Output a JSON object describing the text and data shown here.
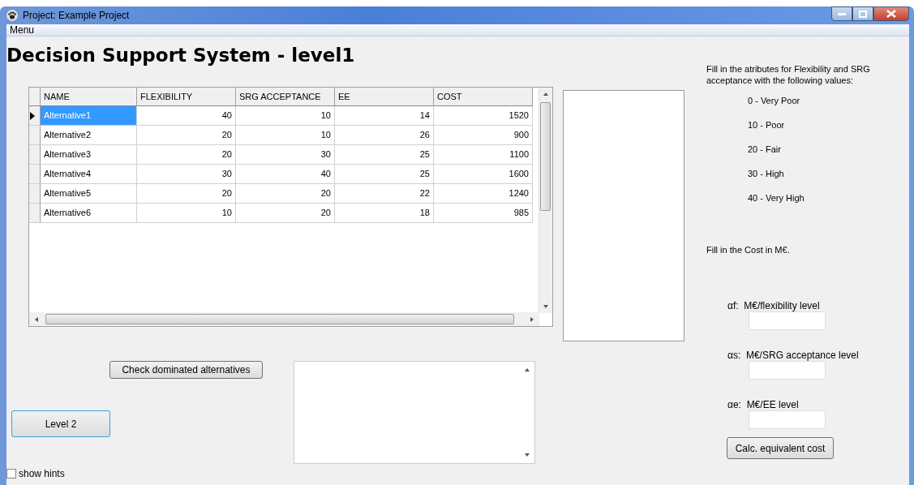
{
  "window": {
    "title": "Project: Example Project"
  },
  "menu": [
    "Menu"
  ],
  "heading": "Decision Support System - level1",
  "table": {
    "columns": [
      "NAME",
      "FLEXIBILITY",
      "SRG ACCEPTANCE",
      "EE",
      "COST"
    ],
    "rows": [
      {
        "cells": [
          "Alternative1",
          "40",
          "10",
          "14",
          "1520"
        ],
        "selected": true
      },
      {
        "cells": [
          "Alternative2",
          "20",
          "10",
          "26",
          "900"
        ],
        "selected": false
      },
      {
        "cells": [
          "Alternative3",
          "20",
          "30",
          "25",
          "1100"
        ],
        "selected": false
      },
      {
        "cells": [
          "Alternative4",
          "30",
          "40",
          "25",
          "1600"
        ],
        "selected": false
      },
      {
        "cells": [
          "Alternative5",
          "20",
          "20",
          "22",
          "1240"
        ],
        "selected": false
      },
      {
        "cells": [
          "Alternative6",
          "10",
          "20",
          "18",
          "985"
        ],
        "selected": false
      }
    ]
  },
  "check_button": "Check dominated alternatives",
  "level_button": "Level 2",
  "show_hints": {
    "label": "show hints",
    "checked": false
  },
  "instructions": "Fill in the atributes for Flexibility and SRG acceptance with the following values:",
  "scale": [
    "0  - Very Poor",
    "10 - Poor",
    "20 - Fair",
    "30 - High",
    "40 - Very High"
  ],
  "cost_instruction": "Fill in the Cost in M€.",
  "cost_fields": [
    {
      "symbol": "αf:",
      "label": "M€/flexibility level"
    },
    {
      "symbol": "αs:",
      "label": "M€/SRG acceptance level"
    },
    {
      "symbol": "αe:",
      "label": "M€/EE level"
    }
  ],
  "calc_button": "Calc. equivalent cost"
}
